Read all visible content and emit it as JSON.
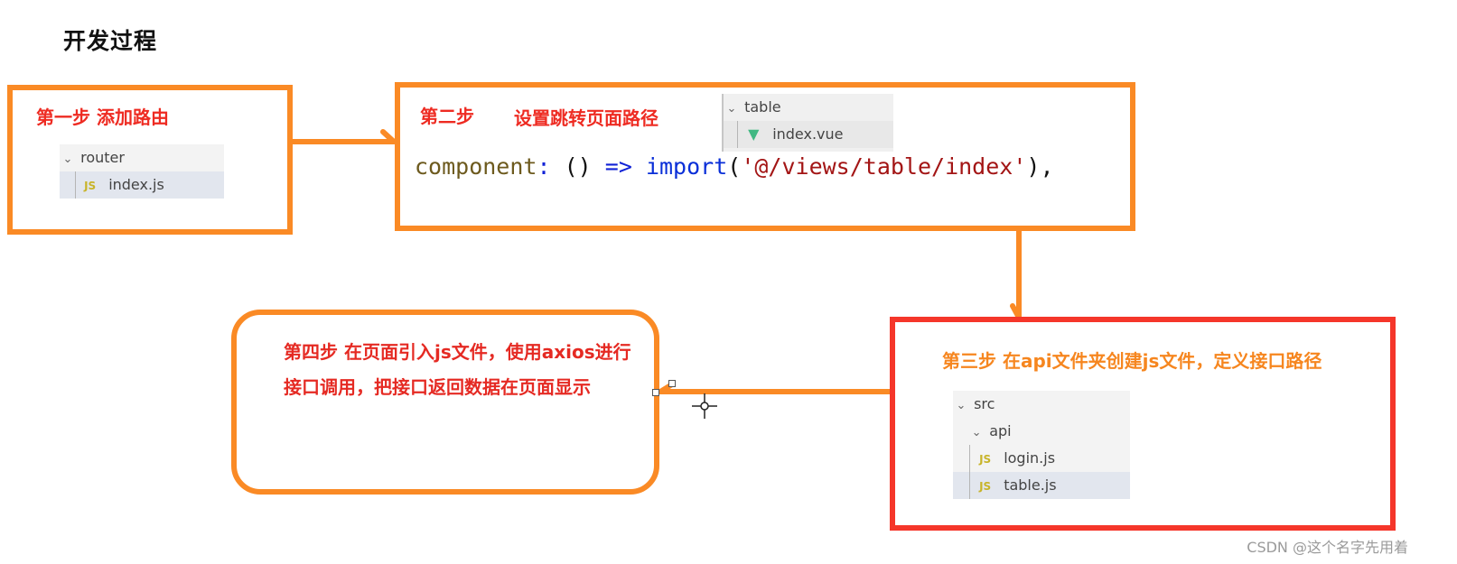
{
  "title": "开发过程",
  "steps": {
    "step1": {
      "label": "第一步 添加路由",
      "tree": [
        {
          "type": "folder",
          "name": "router",
          "expanded": true
        },
        {
          "type": "file",
          "icon": "js-icon",
          "icon_text": "JS",
          "name": "index.js",
          "selected": true
        }
      ]
    },
    "step2": {
      "label": "第二步",
      "desc": "设置跳转页面路径",
      "tree": [
        {
          "type": "folder",
          "name": "table",
          "expanded": true
        },
        {
          "type": "file",
          "icon": "vue-icon",
          "icon_text": "▼",
          "name": "index.vue"
        }
      ],
      "code": {
        "key": "component",
        "colon": ":",
        "parens": "()",
        "arrow": "=>",
        "fn": "import",
        "open": "(",
        "string": "'@/views/table/index'",
        "close": "),"
      }
    },
    "step3": {
      "label": "第三步 在api文件夹创建js文件，定义接口路径",
      "tree": [
        {
          "type": "folder",
          "name": "src",
          "expanded": true
        },
        {
          "type": "folder",
          "name": "api",
          "expanded": true
        },
        {
          "type": "file",
          "icon": "js-icon",
          "icon_text": "JS",
          "name": "login.js"
        },
        {
          "type": "file",
          "icon": "js-icon",
          "icon_text": "JS",
          "name": "table.js",
          "selected": true
        }
      ]
    },
    "step4": {
      "label": "第四步 在页面引入js文件，使用axios进行接口调用，把接口返回数据在页面显示"
    }
  },
  "colors": {
    "orange": "#fa8a25",
    "red_border": "#f5362a",
    "label_red": "#ee2b22",
    "label_orange": "#f6861f"
  },
  "watermark": "CSDN @这个名字先用着"
}
